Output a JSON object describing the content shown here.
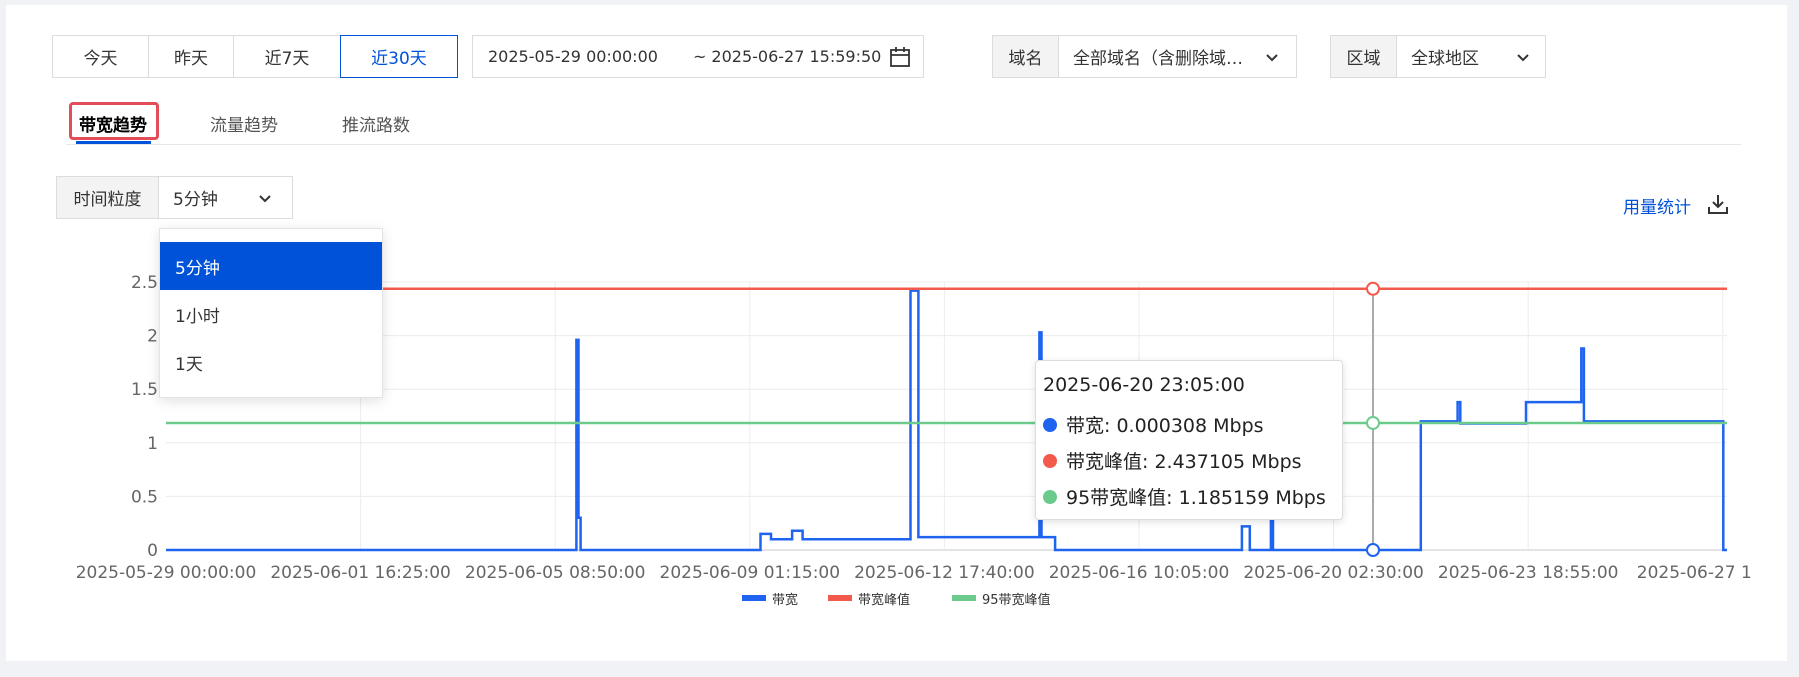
{
  "toolbar": {
    "ranges": [
      "今天",
      "昨天",
      "近7天",
      "近30天"
    ],
    "active_range": "近30天",
    "date_start": "2025-05-29 00:00:00",
    "date_end": "~ 2025-06-27 15:59:50"
  },
  "domain_filter": {
    "label": "域名",
    "value": "全部域名（含删除域…"
  },
  "region_filter": {
    "label": "区域",
    "value": "全球地区"
  },
  "tabs": [
    "带宽趋势",
    "流量趋势",
    "推流路数"
  ],
  "active_tab": "带宽趋势",
  "granularity": {
    "label": "时间粒度",
    "value": "5分钟",
    "options": [
      "5分钟",
      "1小时",
      "1天"
    ]
  },
  "usage_link": "用量统计",
  "tooltip": {
    "time": "2025-06-20 23:05:00",
    "rows": [
      {
        "text": "带宽: 0.000308 Mbps",
        "color": "#1e64f0"
      },
      {
        "text": "带宽峰值: 2.437105 Mbps",
        "color": "#f25b4b"
      },
      {
        "text": "95带宽峰值: 1.185159 Mbps",
        "color": "#6ccb8c"
      }
    ]
  },
  "colors": {
    "accent": "#0052d9",
    "bandwidth": "#1e64f0",
    "peak": "#f25b4b",
    "p95": "#6ccb8c"
  },
  "chart_data": {
    "type": "line",
    "x_ticks": [
      "2025-05-29 00:00:00",
      "2025-06-01 16:25:00",
      "2025-06-05 08:50:00",
      "2025-06-09 01:15:00",
      "2025-06-12 17:40:00",
      "2025-06-16 10:05:00",
      "2025-06-20 02:30:00",
      "2025-06-23 18:55:00",
      "2025-06-27 1"
    ],
    "y_ticks": [
      "0",
      "0.5",
      "1",
      "1.5",
      "2",
      "2.5"
    ],
    "ylim": [
      0,
      2.5
    ],
    "x_range_days": [
      0,
      29.67
    ],
    "legend": [
      "带宽",
      "带宽峰值",
      "95带宽峰值"
    ],
    "series": [
      {
        "name": "带宽",
        "x_days": [
          0,
          7.8,
          7.8,
          7.84,
          7.84,
          7.88,
          7.88,
          11.3,
          11.3,
          11.5,
          11.5,
          11.9,
          11.9,
          12.1,
          12.1,
          14.15,
          14.15,
          14.3,
          14.3,
          16.6,
          16.6,
          16.64,
          16.64,
          16.9,
          16.9,
          20.45,
          20.45,
          20.6,
          20.6,
          21.0,
          21.0,
          21.04,
          21.04,
          23.85,
          23.85,
          24.55,
          24.55,
          24.6,
          24.6,
          25.85,
          25.85,
          26.9,
          26.9,
          26.95,
          26.95,
          29.6,
          29.6,
          29.67
        ],
        "values": [
          0,
          0,
          1.96,
          1.96,
          0.3,
          0.3,
          0,
          0,
          0.15,
          0.15,
          0.1,
          0.1,
          0.18,
          0.18,
          0.1,
          0.1,
          2.42,
          2.42,
          0.12,
          0.12,
          2.03,
          2.03,
          0.12,
          0.12,
          0,
          0,
          0.22,
          0.22,
          0,
          0,
          0.31,
          0.31,
          0,
          0,
          1.2,
          1.2,
          1.38,
          1.38,
          1.18,
          1.18,
          1.38,
          1.38,
          1.88,
          1.88,
          1.2,
          1.2,
          0,
          0
        ]
      },
      {
        "name": "带宽峰值",
        "value": 2.437105
      },
      {
        "name": "95带宽峰值",
        "value": 1.185159
      }
    ]
  }
}
